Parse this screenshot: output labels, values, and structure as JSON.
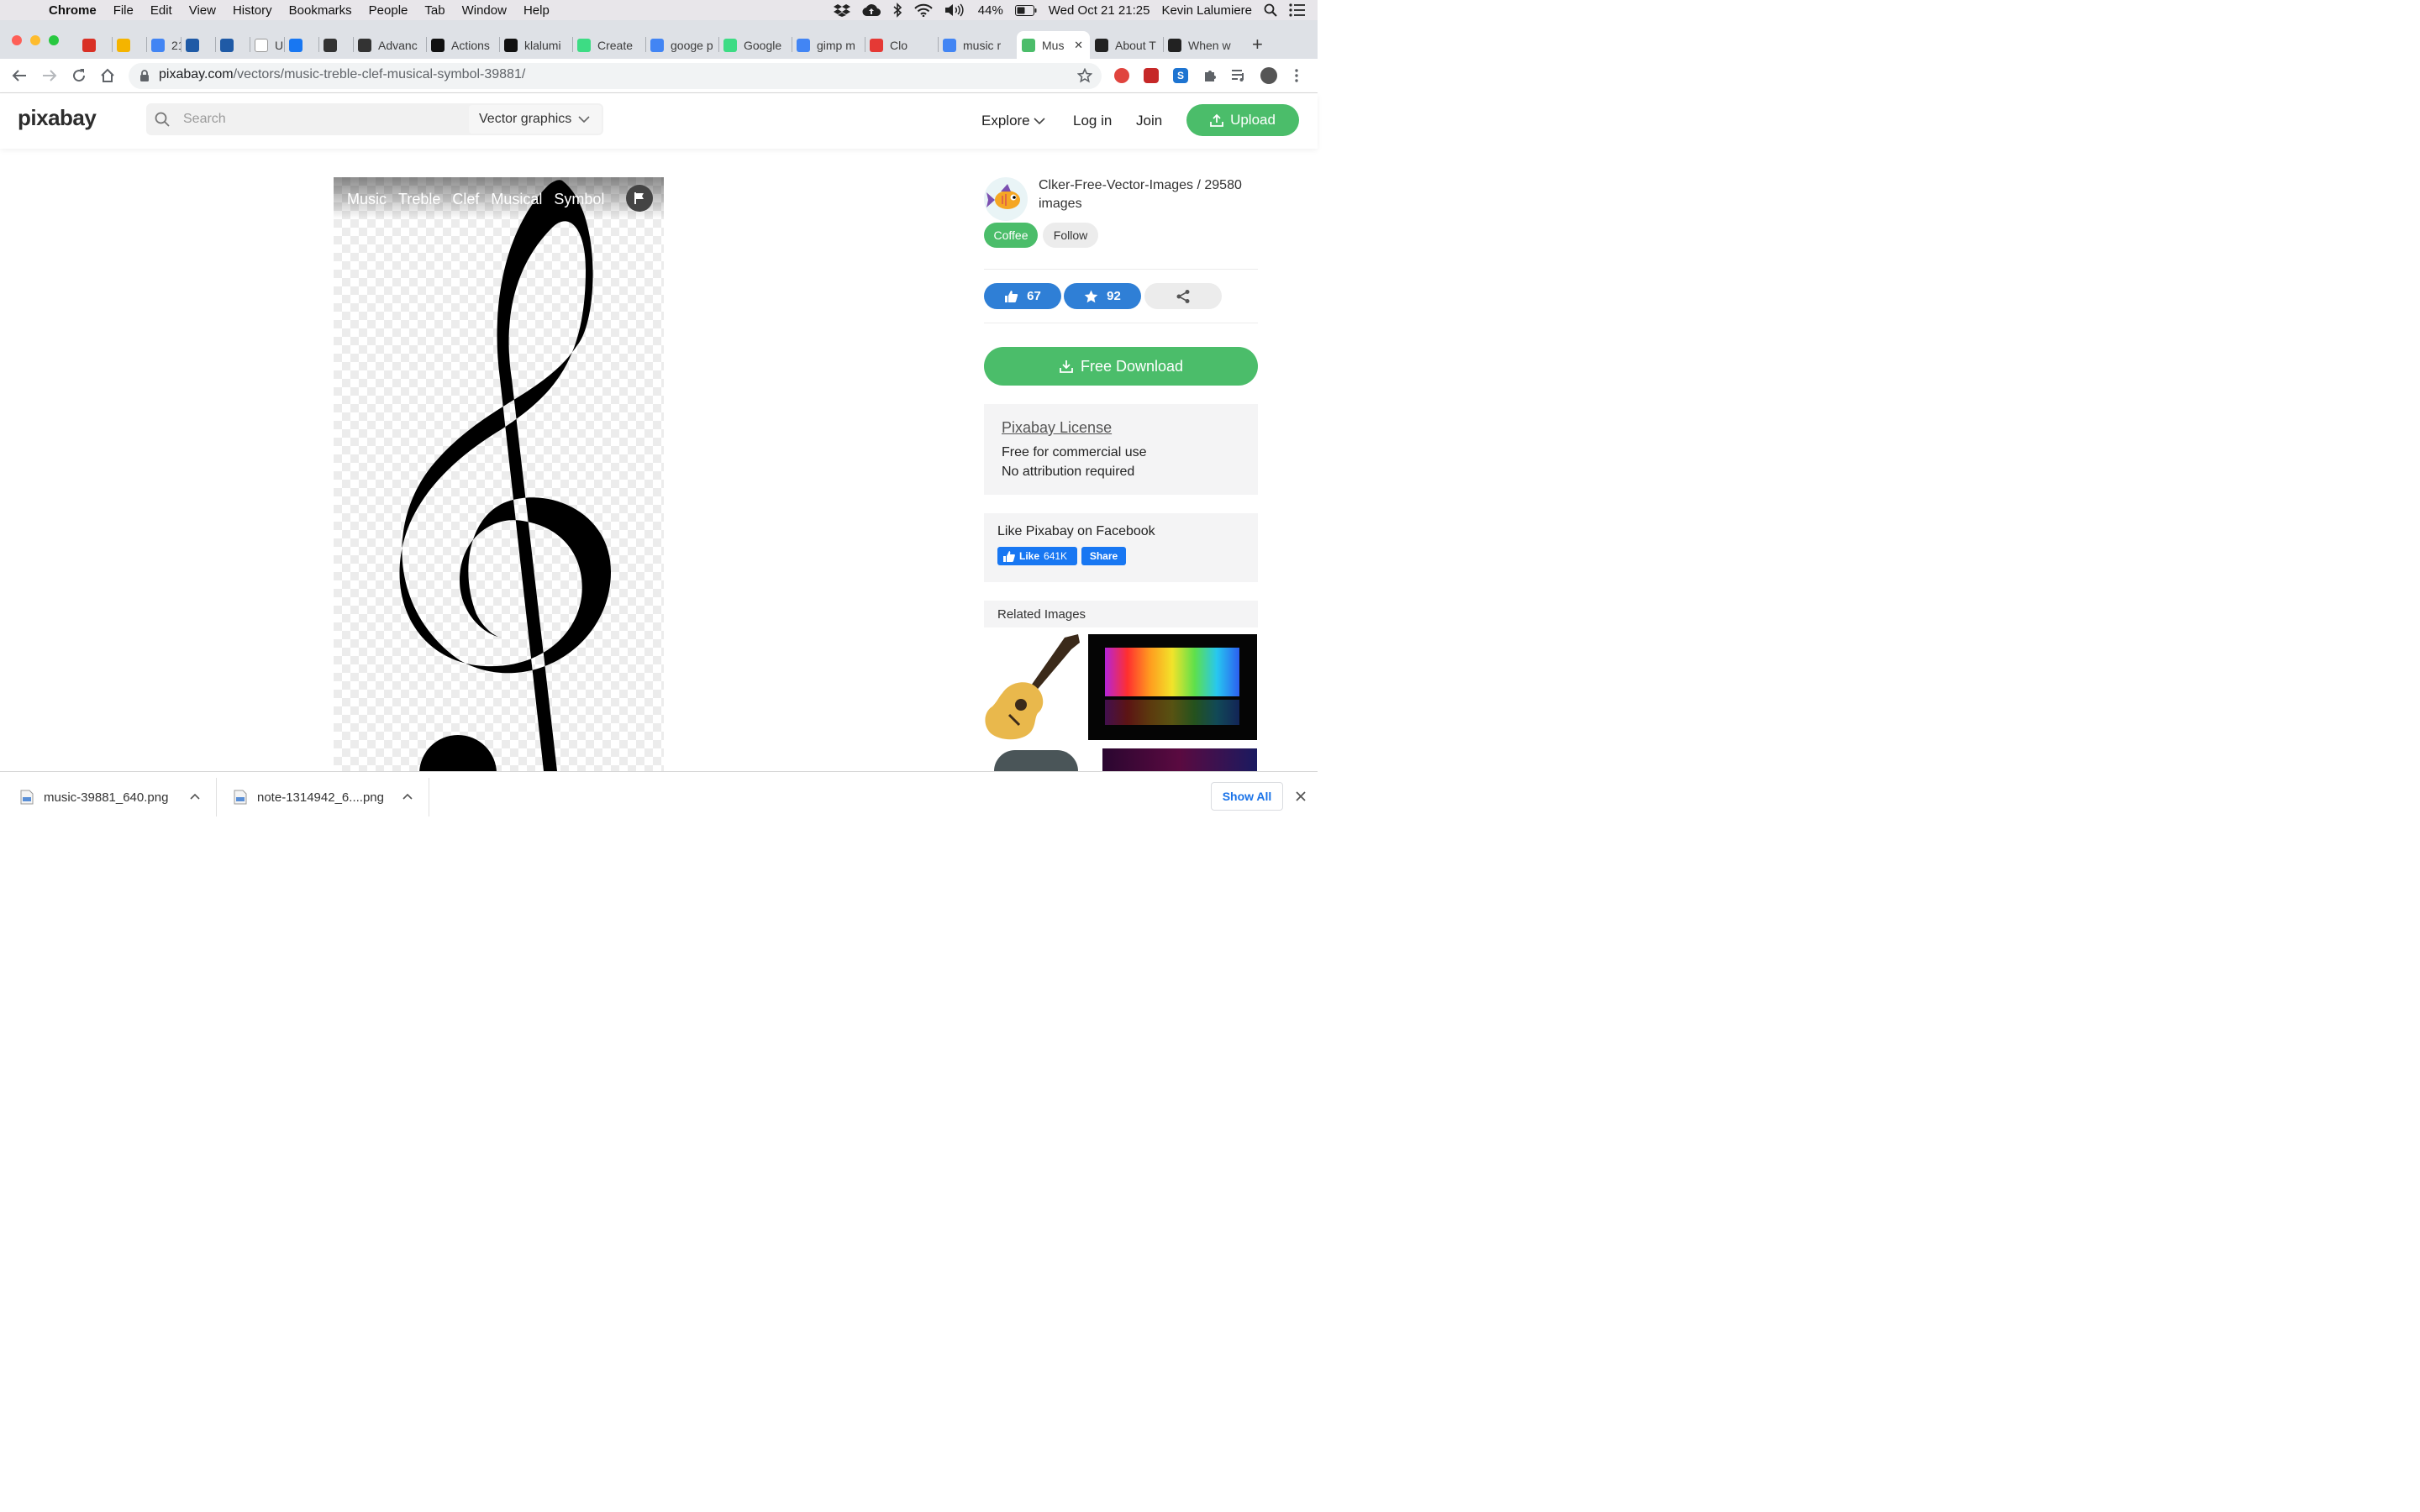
{
  "menubar": {
    "app": "Chrome",
    "items": [
      "File",
      "Edit",
      "View",
      "History",
      "Bookmarks",
      "People",
      "Tab",
      "Window",
      "Help"
    ],
    "battery": "44%",
    "datetime": "Wed Oct 21  21:25",
    "user": "Kevin Lalumiere"
  },
  "tabs": [
    {
      "label": "",
      "icon": "gmail-icon",
      "color": "#d93025"
    },
    {
      "label": "",
      "icon": "keep-icon",
      "color": "#f5b400"
    },
    {
      "label": "21",
      "icon": "calendar-icon",
      "color": "#4285f4"
    },
    {
      "label": "",
      "icon": "fleur-de-lis-icon",
      "color": "#1f5aa6"
    },
    {
      "label": "",
      "icon": "fleur-de-lis-icon",
      "color": "#1f5aa6"
    },
    {
      "label": "UF",
      "icon": "uf-icon",
      "color": "#ffffff"
    },
    {
      "label": "",
      "icon": "facebook-icon",
      "color": "#1877f2"
    },
    {
      "label": "",
      "icon": "record-icon",
      "color": "#333333"
    },
    {
      "label": "Advanc",
      "icon": "document-icon",
      "color": "#333333"
    },
    {
      "label": "Actions",
      "icon": "github-icon",
      "color": "#111111"
    },
    {
      "label": "klalumi",
      "icon": "github-icon",
      "color": "#111111"
    },
    {
      "label": "Create",
      "icon": "android-icon",
      "color": "#3ddc84"
    },
    {
      "label": "googe p",
      "icon": "google-icon",
      "color": "#4285f4"
    },
    {
      "label": "Google",
      "icon": "android-icon",
      "color": "#3ddc84"
    },
    {
      "label": "gimp m",
      "icon": "google-icon",
      "color": "#4285f4"
    },
    {
      "label": "Clo",
      "icon": "play-icon",
      "color": "#e53935"
    },
    {
      "label": "music r",
      "icon": "google-icon",
      "color": "#4285f4"
    },
    {
      "label": "Mus",
      "icon": "pixabay-icon",
      "color": "#4bbd6a",
      "active": true
    },
    {
      "label": "About T",
      "icon": "cc-icon",
      "color": "#222222"
    },
    {
      "label": "When w",
      "icon": "cc-icon",
      "color": "#222222"
    }
  ],
  "address": {
    "domain": "pixabay.com",
    "path": "/vectors/music-treble-clef-musical-symbol-39881/"
  },
  "site": {
    "logo": "pixabay",
    "search_placeholder": "Search",
    "search_type": "Vector graphics",
    "nav": {
      "explore": "Explore",
      "login": "Log in",
      "join": "Join",
      "upload": "Upload"
    }
  },
  "image": {
    "tags": [
      "Music",
      "Treble",
      "Clef",
      "Musical",
      "Symbol"
    ]
  },
  "sidebar": {
    "author": "Clker-Free-Vector-Images / 29580 images",
    "coffee": "Coffee",
    "follow": "Follow",
    "likes": "67",
    "favorites": "92",
    "download": "Free Download",
    "license_title": "Pixabay License",
    "license_line1": "Free for commercial use",
    "license_line2": "No attribution required",
    "facebook_title": "Like Pixabay on Facebook",
    "fb_like": "Like",
    "fb_count": "641K",
    "fb_share": "Share",
    "related_title": "Related Images"
  },
  "downloads": [
    {
      "name": "music-39881_640.png"
    },
    {
      "name": "note-1314942_6....png"
    }
  ],
  "downloads_show_all": "Show All",
  "colors": {
    "accent": "#4bbd6a",
    "blue_pill": "#2f7fd6"
  }
}
